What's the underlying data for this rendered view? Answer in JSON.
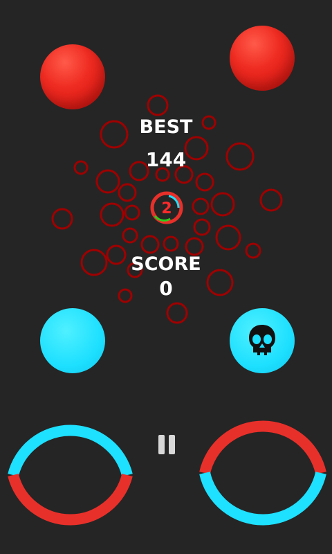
{
  "hud": {
    "best_label": "BEST",
    "best_value": "144",
    "score_label": "SCORE",
    "score_value": "0",
    "level_number": "2"
  },
  "icons": {
    "pause": "pause-icon",
    "skull": "skull-icon"
  },
  "colors": {
    "background": "#252525",
    "red": "#e8302a",
    "blue": "#1ee0ff",
    "ring_outline": "#a00000",
    "level_green": "#2ad01a"
  }
}
